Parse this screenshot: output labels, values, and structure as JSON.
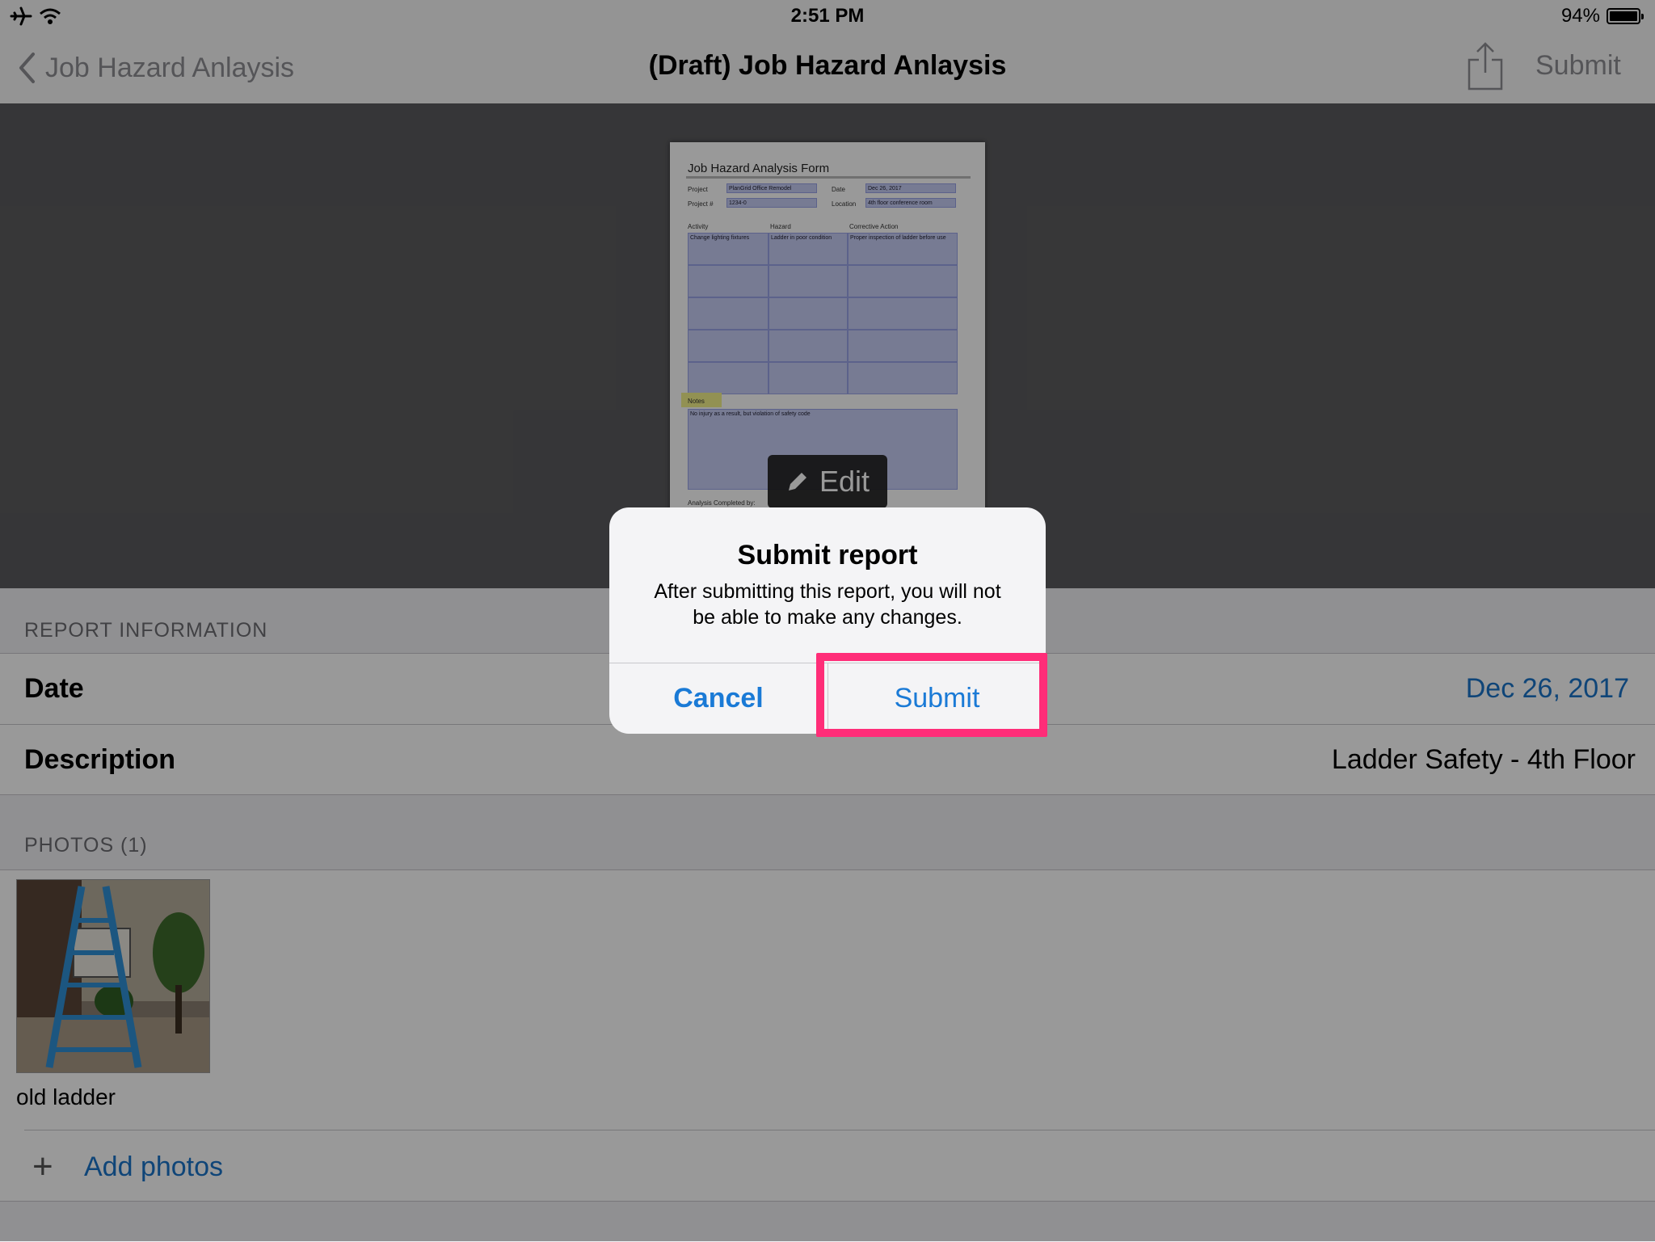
{
  "status_bar": {
    "time": "2:51 PM",
    "battery_percent": "94%",
    "battery_level": 0.94,
    "icons": [
      "airplane-icon",
      "wifi-icon",
      "battery-icon"
    ]
  },
  "nav": {
    "back_label": "Job Hazard Anlaysis",
    "title": "(Draft) Job Hazard Anlaysis",
    "submit_label": "Submit",
    "share_icon": "share-icon"
  },
  "form_preview": {
    "title": "Job Hazard Analysis Form",
    "project_label": "Project",
    "project_value": "PlanGrid Office Remodel",
    "project_num_label": "Project #",
    "project_num_value": "1234-0",
    "date_label": "Date",
    "date_value": "Dec 26, 2017",
    "location_label": "Location",
    "location_value": "4th floor conference room",
    "col_activity": "Activity",
    "col_hazard": "Hazard",
    "col_corrective": "Corrective Action",
    "row1_activity": "Change lighting fixtures",
    "row1_hazard": "Ladder in poor condition",
    "row1_corrective": "Proper inspection of ladder before use",
    "notes_label": "Notes",
    "notes_value": "No injury as a result, but violation of safety code",
    "completed_by_label": "Analysis Completed by:",
    "edit_label": "Edit"
  },
  "report_info": {
    "header": "REPORT INFORMATION",
    "date_label": "Date",
    "date_value": "Dec 26, 2017",
    "description_label": "Description",
    "description_value": "Ladder Safety - 4th Floor"
  },
  "photos": {
    "header": "PHOTOS (1)",
    "items": [
      {
        "caption": "old ladder"
      }
    ],
    "add_label": "Add photos"
  },
  "alert": {
    "title": "Submit report",
    "message": "After submitting this report, you will not be able to make any changes.",
    "cancel_label": "Cancel",
    "submit_label": "Submit"
  },
  "colors": {
    "accent": "#1a73c8",
    "highlight": "#ff2d78"
  }
}
